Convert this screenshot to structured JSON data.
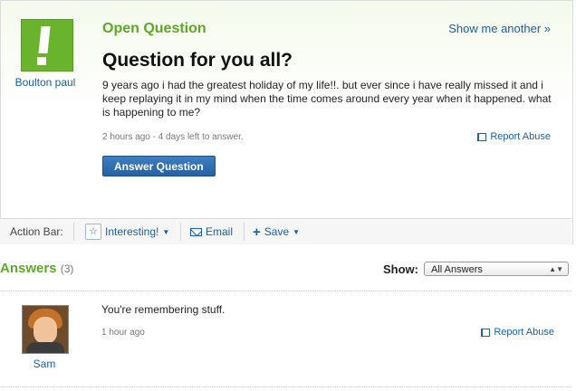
{
  "question": {
    "label": "Open Question",
    "show_another": "Show me another »",
    "asker": "Boulton paul",
    "title": "Question for you all?",
    "body": "9 years ago i had the greatest holiday of my life!!. but ever since i have really missed it and i keep replaying it in my mind when the time comes around every year when it happened. what is happening to me?",
    "meta": "2 hours ago - 4 days left to answer.",
    "report": "Report Abuse",
    "answer_button": "Answer Question"
  },
  "action_bar": {
    "label": "Action Bar:",
    "interesting": "Interesting!",
    "email": "Email",
    "save": "Save"
  },
  "answers": {
    "heading": "Answers",
    "count": "(3)",
    "show_label": "Show:",
    "filter": "All Answers",
    "items": [
      {
        "user": "Sam",
        "text": "You're remembering stuff.",
        "time": "1 hour ago",
        "report": "Report Abuse"
      }
    ]
  },
  "colors": {
    "accent_green": "#5fa728",
    "link_blue": "#1b5fa6",
    "button_blue": "#2661a3"
  }
}
